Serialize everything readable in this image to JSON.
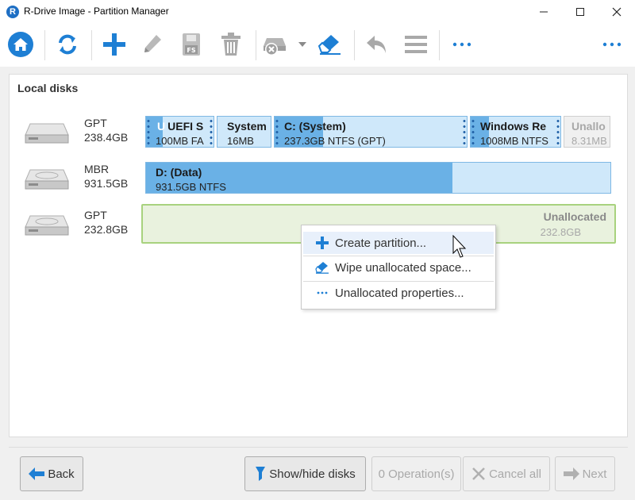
{
  "window": {
    "title": "R-Drive Image - Partition Manager",
    "logo_letter": "R",
    "minimize": "—",
    "maximize": "☐",
    "close": "✕"
  },
  "toolbar": {
    "buttons": [
      "home-icon",
      "refresh-icon",
      "add-icon",
      "edit-icon",
      "format-fs-icon",
      "delete-icon",
      "disk-remove-icon",
      "dropdown-arrow-icon",
      "wipe-eraser-icon",
      "undo-icon",
      "menu-lines-icon",
      "more-icon",
      "more-right-icon"
    ],
    "fs_label": "FS"
  },
  "main": {
    "section_title": "Local disks",
    "disks": [
      {
        "type": "GPT",
        "size": "238.4GB",
        "partitions": [
          {
            "name": "UEFI S",
            "info": "100MB FA",
            "fill": 0.25
          },
          {
            "name": "System",
            "info": "16MB",
            "fill": 0
          },
          {
            "name": "C: (System)",
            "info": "237.3GB NTFS (GPT)",
            "fill": 0.25
          },
          {
            "name": "Windows Re",
            "info": "1008MB NTFS",
            "fill": 0.2
          },
          {
            "name": "Unallo",
            "info": "8.31MB",
            "fill": 0
          }
        ]
      },
      {
        "type": "MBR",
        "size": "931.5GB",
        "partitions": [
          {
            "name": "D: (Data)",
            "info": "931.5GB NTFS",
            "fill": 0.66
          }
        ]
      },
      {
        "type": "GPT",
        "size": "232.8GB",
        "partitions": [
          {
            "name": "Unallocated",
            "info": "232.8GB"
          }
        ]
      }
    ]
  },
  "context_menu": {
    "items": [
      {
        "label": "Create partition...",
        "icon": "plus-icon"
      },
      {
        "label": "Wipe unallocated space...",
        "icon": "eraser-icon"
      },
      {
        "label": "Unallocated properties...",
        "icon": "ellipsis-icon"
      }
    ]
  },
  "bottom": {
    "back": "Back",
    "show_hide": "Show/hide disks",
    "operations": "0 Operation(s)",
    "cancel_all": "Cancel all",
    "next": "Next"
  },
  "colors": {
    "accent": "#1e7fd4",
    "partition_fill": "#6ab1e6",
    "partition_bg": "#cfe8fa",
    "unallocated_bg": "#e9f2de",
    "unallocated_border": "#a8d27e"
  }
}
